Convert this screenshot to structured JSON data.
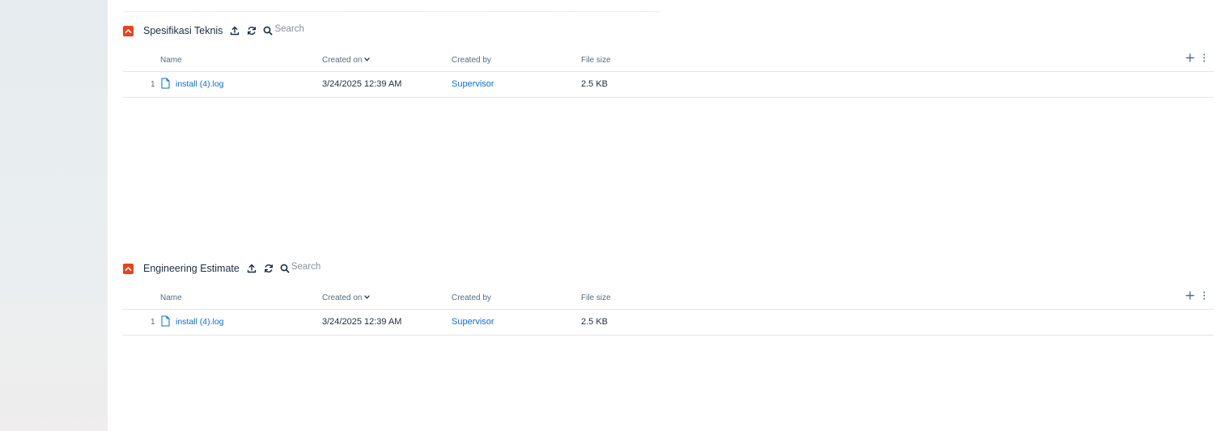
{
  "sections": [
    {
      "title": "Spesifikasi Teknis",
      "search_placeholder": "Search",
      "columns": {
        "name": "Name",
        "created_on": "Created on",
        "created_by": "Created by",
        "file_size": "File size"
      },
      "rows": [
        {
          "index": "1",
          "name": "install (4).log",
          "created_on": "3/24/2025 12:39 AM",
          "created_by": "Supervisor",
          "file_size": "2.5 KB"
        }
      ]
    },
    {
      "title": "Engineering Estimate",
      "search_placeholder": "Search",
      "columns": {
        "name": "Name",
        "created_on": "Created on",
        "created_by": "Created by",
        "file_size": "File size"
      },
      "rows": [
        {
          "index": "1",
          "name": "install (4).log",
          "created_on": "3/24/2025 12:39 AM",
          "created_by": "Supervisor",
          "file_size": "2.5 KB"
        }
      ]
    }
  ],
  "colors": {
    "accent": "#e8411e",
    "link": "#0a6ed1",
    "text": "#1d2d3e",
    "header_text": "#556b82",
    "divider": "#e5e5e5"
  },
  "icons": [
    "chevron-up-icon",
    "upload-icon",
    "refresh-icon",
    "search-icon",
    "file-icon",
    "sort-down-icon",
    "plus-icon",
    "more-vertical-icon"
  ]
}
